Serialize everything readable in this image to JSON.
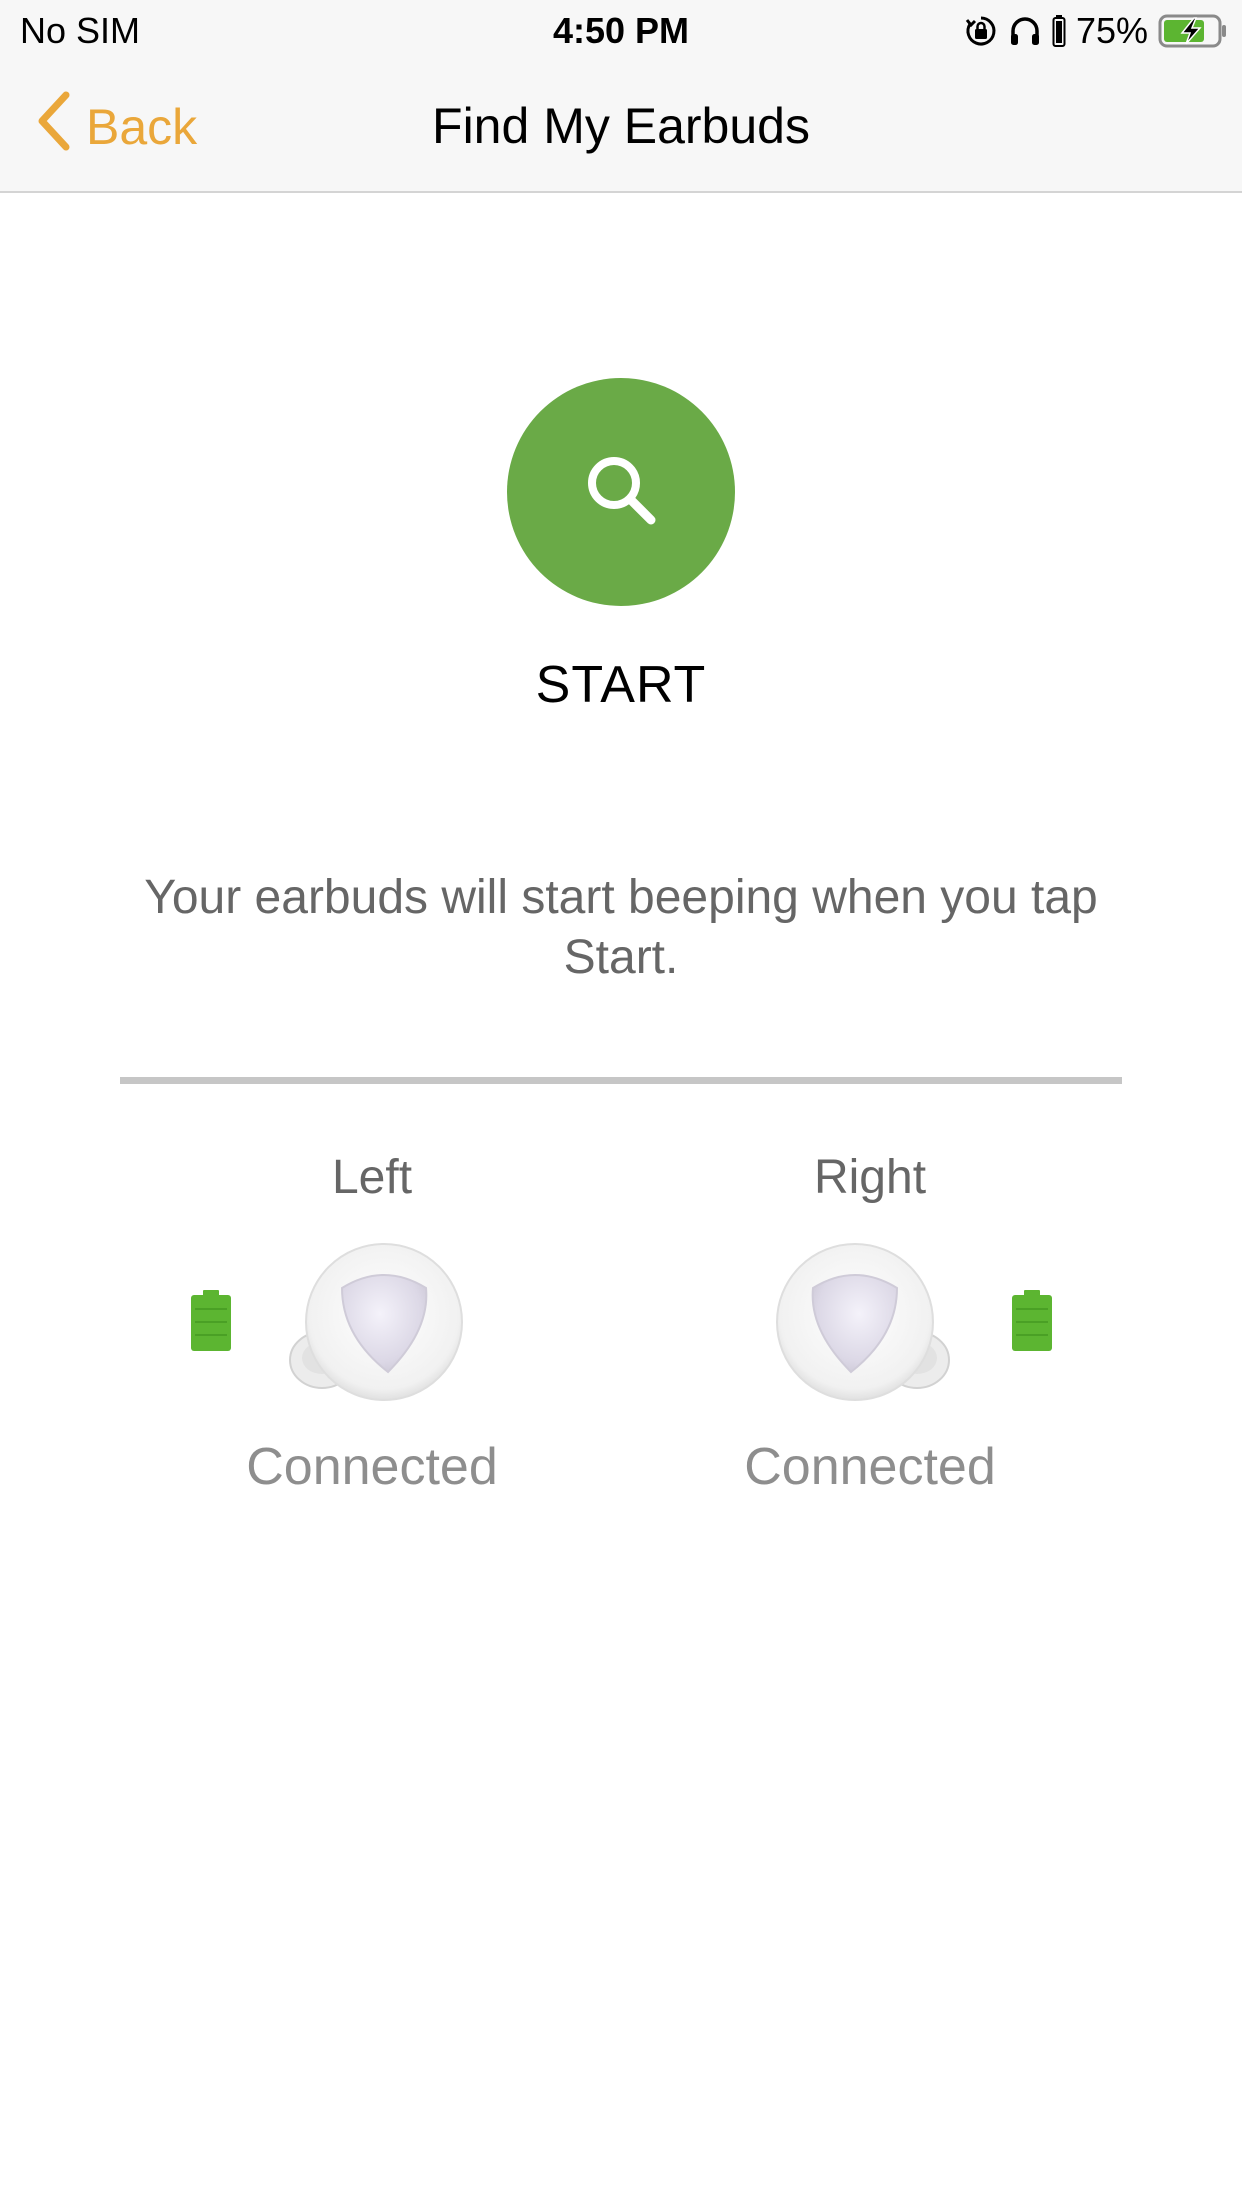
{
  "status_bar": {
    "carrier": "No SIM",
    "time": "4:50 PM",
    "battery_percent": "75%",
    "icons": [
      "orientation-lock-icon",
      "headphones-icon",
      "headphone-battery-icon",
      "battery-charging-icon"
    ]
  },
  "nav": {
    "back_label": "Back",
    "title": "Find My Earbuds"
  },
  "find": {
    "start_label": "START",
    "hint": "Your earbuds will start beeping when you tap Start."
  },
  "earbuds": {
    "left": {
      "label": "Left",
      "status": "Connected",
      "battery_level": 1.0
    },
    "right": {
      "label": "Right",
      "status": "Connected",
      "battery_level": 1.0
    }
  },
  "colors": {
    "accent": "#eaa73a",
    "start_green": "#6aaa47",
    "battery_green": "#5cb531"
  }
}
